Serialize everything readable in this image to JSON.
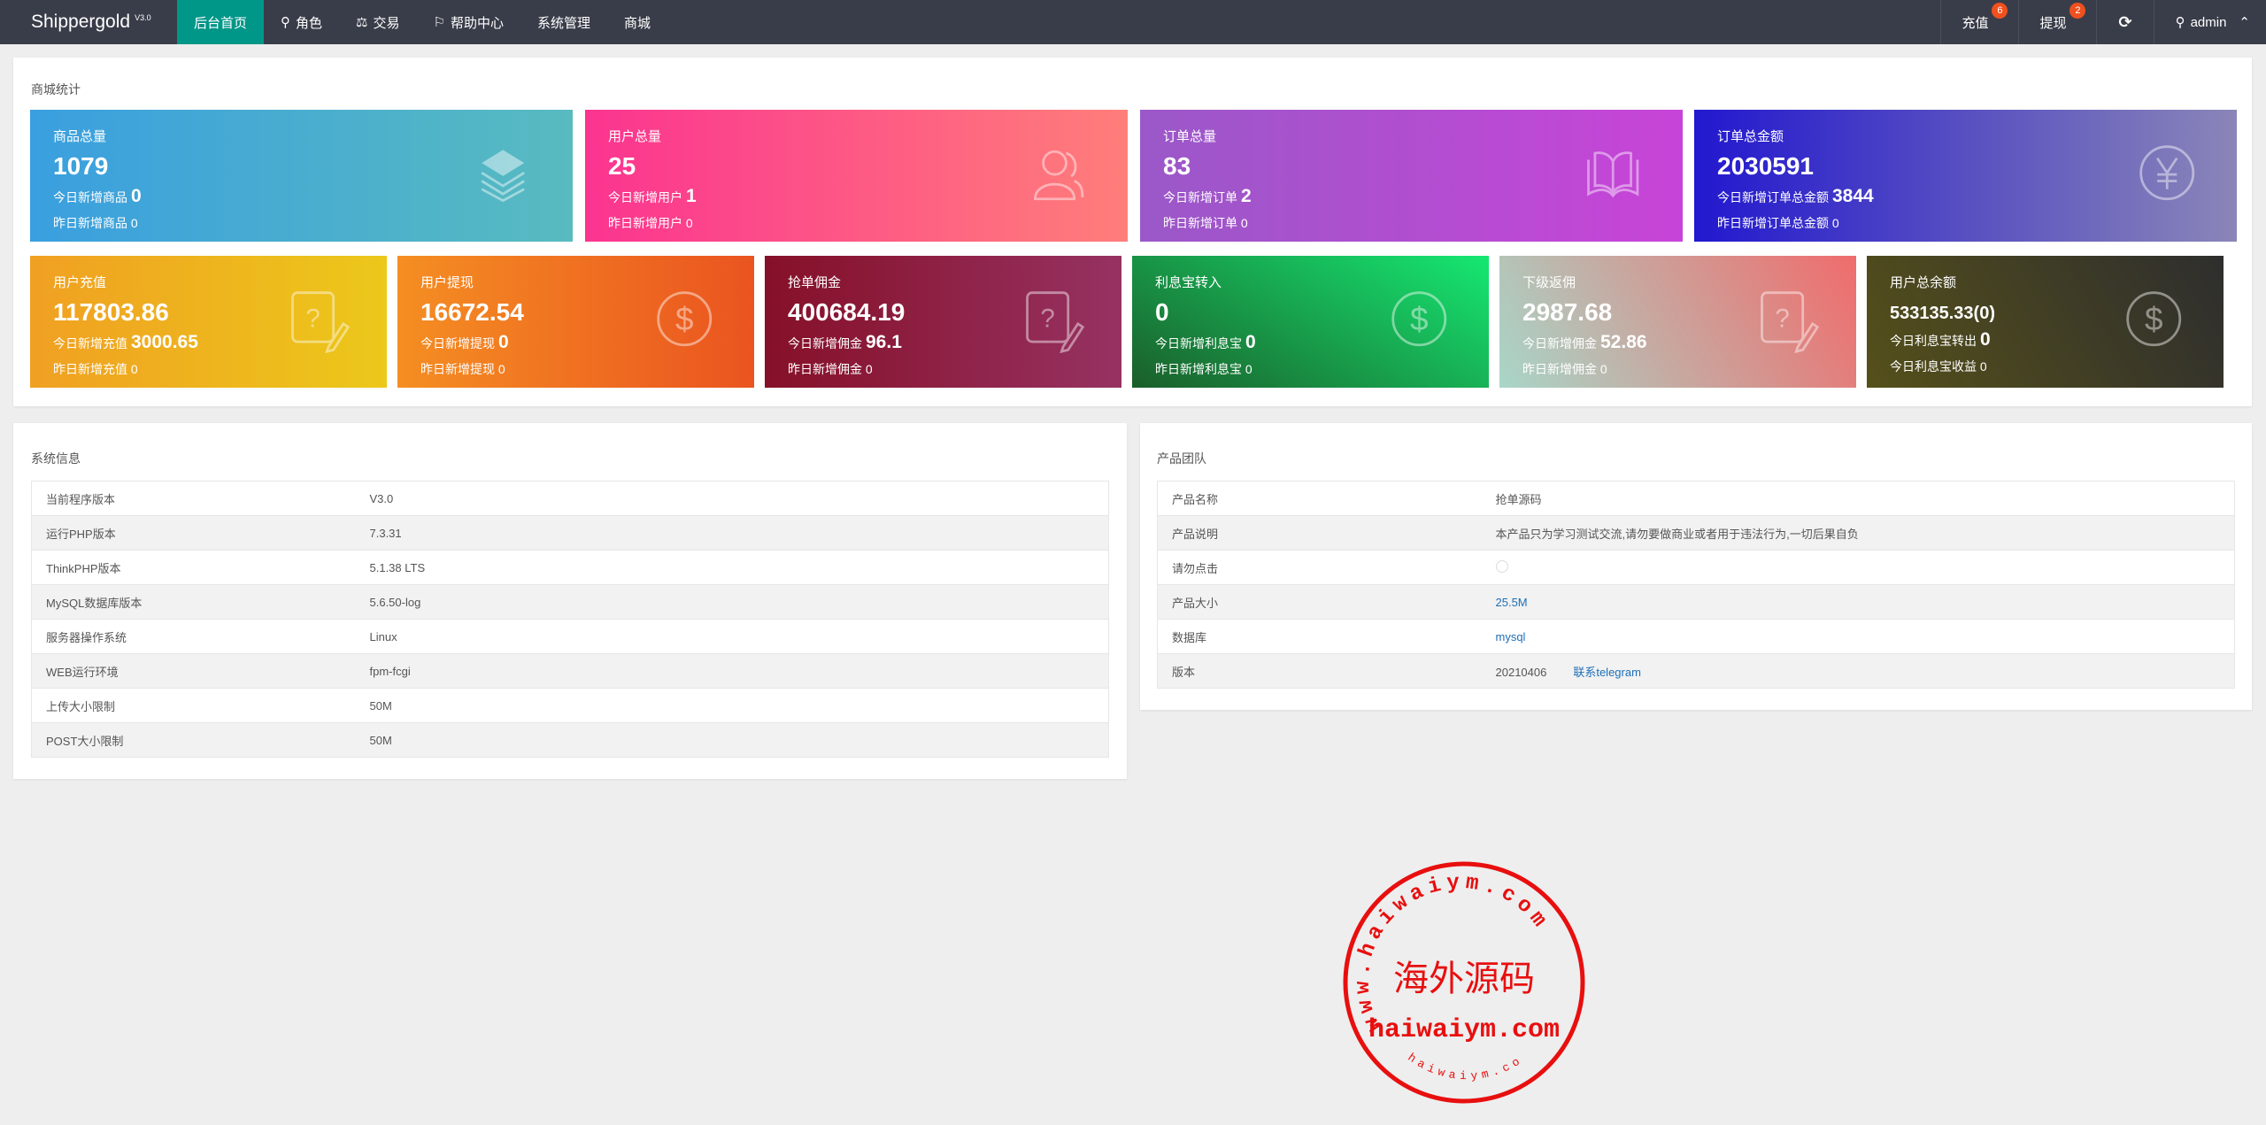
{
  "nav": {
    "brand": "Shippergold",
    "version": "V3.0",
    "items": [
      {
        "label": "后台首页",
        "icon": "home"
      },
      {
        "label": "角色",
        "icon": "user-icon"
      },
      {
        "label": "交易",
        "icon": "scale-icon"
      },
      {
        "label": "帮助中心",
        "icon": "flag-icon"
      },
      {
        "label": "系统管理"
      },
      {
        "label": "商城"
      }
    ],
    "right": {
      "recharge": "充值",
      "recharge_badge": "6",
      "withdraw": "提现",
      "withdraw_badge": "2",
      "user": "admin"
    }
  },
  "stats": {
    "title": "商城统计",
    "cards": [
      {
        "title": "商品总量",
        "value": "1079",
        "today_label": "今日新增商品",
        "today": "0",
        "yest_label": "昨日新增商品",
        "yest": "0",
        "icon": "layers-icon"
      },
      {
        "title": "用户总量",
        "value": "25",
        "today_label": "今日新增用户",
        "today": "1",
        "yest_label": "昨日新增用户",
        "yest": "0",
        "icon": "users-icon"
      },
      {
        "title": "订单总量",
        "value": "83",
        "today_label": "今日新增订单",
        "today": "2",
        "yest_label": "昨日新增订单",
        "yest": "0",
        "icon": "book-icon"
      },
      {
        "title": "订单总金额",
        "value": "2030591",
        "today_label": "今日新增订单总金额",
        "today": "3844",
        "yest_label": "昨日新增订单总金额",
        "yest": "0",
        "icon": "yen-icon"
      },
      {
        "title": "用户充值",
        "value": "117803.86",
        "today_label": "今日新增充值",
        "today": "3000.65",
        "yest_label": "昨日新增充值",
        "yest": "0",
        "icon": "question-edit-icon"
      },
      {
        "title": "用户提现",
        "value": "16672.54",
        "today_label": "今日新增提现",
        "today": "0",
        "yest_label": "昨日新增提现",
        "yest": "0",
        "icon": "dollar-icon"
      },
      {
        "title": "抢单佣金",
        "value": "400684.19",
        "today_label": "今日新增佣金",
        "today": "96.1",
        "yest_label": "昨日新增佣金",
        "yest": "0",
        "icon": "question-edit-icon"
      },
      {
        "title": "利息宝转入",
        "value": "0",
        "today_label": "今日新增利息宝",
        "today": "0",
        "yest_label": "昨日新增利息宝",
        "yest": "0",
        "icon": "dollar-icon"
      },
      {
        "title": "下级返佣",
        "value": "2987.68",
        "today_label": "今日新增佣金",
        "today": "52.86",
        "yest_label": "昨日新增佣金",
        "yest": "0",
        "icon": "question-edit-icon"
      },
      {
        "title": "用户总余额",
        "value": "533135.33(0)",
        "today_label": "今日利息宝转出",
        "today": "0",
        "yest_label": "今日利息宝收益",
        "yest": "0",
        "icon": "dollar-icon"
      }
    ]
  },
  "sysinfo": {
    "title": "系统信息",
    "rows": [
      [
        "当前程序版本",
        "V3.0"
      ],
      [
        "运行PHP版本",
        "7.3.31"
      ],
      [
        "ThinkPHP版本",
        "5.1.38 LTS"
      ],
      [
        "MySQL数据库版本",
        "5.6.50-log"
      ],
      [
        "服务器操作系统",
        "Linux"
      ],
      [
        "WEB运行环境",
        "fpm-fcgi"
      ],
      [
        "上传大小限制",
        "50M"
      ],
      [
        "POST大小限制",
        "50M"
      ]
    ]
  },
  "team": {
    "title": "产品团队",
    "rows": [
      [
        "产品名称",
        "抢单源码"
      ],
      [
        "产品说明",
        "本产品只为学习测试交流,请勿要做商业或者用于违法行为,一切后果自负"
      ],
      [
        "请勿点击",
        ""
      ],
      [
        "产品大小",
        "25.5M"
      ],
      [
        "数据库",
        "mysql"
      ],
      [
        "版本",
        "20210406"
      ]
    ],
    "telegram": "联系telegram"
  },
  "stamp": {
    "center": "海外源码",
    "line": "haiwaiym.com",
    "ring": "www.haiwaiym.com",
    "bottom": "haiwaiym.com"
  },
  "colors": {
    "nav": "#393d49",
    "active": "#009688",
    "badge": "#f0501e",
    "link": "#1e6fb8"
  }
}
